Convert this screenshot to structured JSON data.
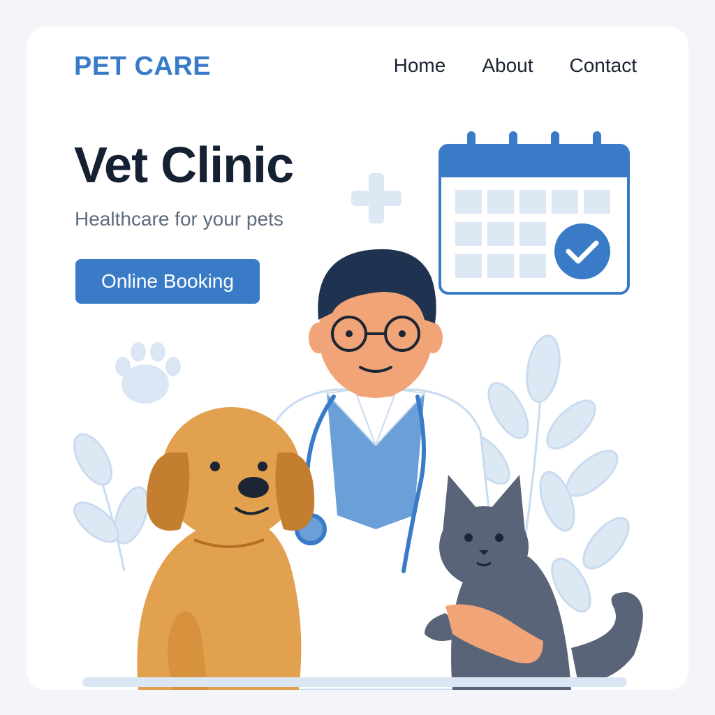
{
  "header": {
    "logo": "PET CARE",
    "nav": [
      "Home",
      "About",
      "Contact"
    ]
  },
  "hero": {
    "title": "Vet Clinic",
    "subtitle": "Healthcare for your pets",
    "cta_label": "Online Booking"
  },
  "icons": {
    "plus": "plus-icon",
    "calendar": "calendar-icon",
    "check": "check-icon",
    "paw": "paw-print-icon"
  },
  "colors": {
    "brand": "#3a7bc8",
    "title": "#152033",
    "subtitle": "#5d6b7c",
    "dog": "#e2a14f",
    "cat": "#5a6478",
    "leaf": "#dbe6f4"
  }
}
